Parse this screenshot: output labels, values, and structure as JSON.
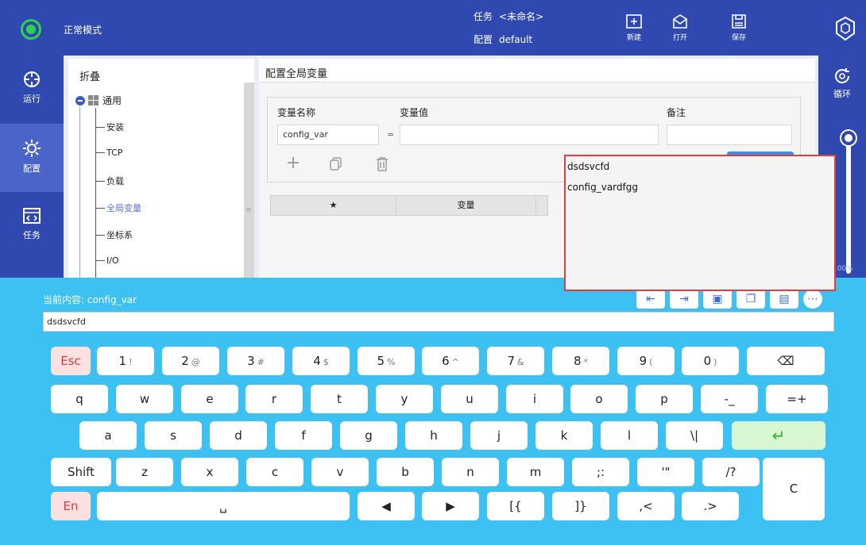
{
  "topbar": {
    "mode_label": "正常模式",
    "task_label": "任务",
    "task_value": "<未命名>",
    "config_label": "配置",
    "config_value": "default",
    "new_label": "新建",
    "open_label": "打开",
    "save_label": "保存"
  },
  "leftnav": {
    "items": [
      {
        "label": "运行",
        "icon": "run-icon"
      },
      {
        "label": "配置",
        "icon": "config-gear-icon"
      },
      {
        "label": "任务",
        "icon": "code-window-icon"
      }
    ]
  },
  "rightnav": {
    "loop_label": "循环",
    "speed_label": "100%",
    "speed_value": 100
  },
  "tree": {
    "title": "折叠",
    "root_label": "通用",
    "children": [
      "安装",
      "TCP",
      "负载",
      "全局变量",
      "坐标系",
      "I/O"
    ],
    "selected": "全局变量"
  },
  "main": {
    "title": "配置全局变量",
    "name_label": "变量名称",
    "value_label": "变量值",
    "note_label": "备注",
    "name_value": "config_var",
    "equals": "=",
    "table_headers": [
      "★",
      "变量"
    ]
  },
  "suggestions": [
    "dsdsvcfd",
    "config_vardfgg"
  ],
  "keyboard": {
    "current_label": "当前内容: config_var",
    "input_value": "dsdsvcfd",
    "edit_tools": [
      "move-left-icon",
      "move-right-icon",
      "select-all-icon",
      "copy-icon",
      "paste-icon",
      "more-icon"
    ],
    "row1": [
      {
        "main": "Esc",
        "sub": ""
      },
      {
        "main": "1",
        "sub": "!"
      },
      {
        "main": "2",
        "sub": "@"
      },
      {
        "main": "3",
        "sub": "#"
      },
      {
        "main": "4",
        "sub": "$"
      },
      {
        "main": "5",
        "sub": "%"
      },
      {
        "main": "6",
        "sub": "^"
      },
      {
        "main": "7",
        "sub": "&"
      },
      {
        "main": "8",
        "sub": "*"
      },
      {
        "main": "9",
        "sub": "("
      },
      {
        "main": "0",
        "sub": ")"
      },
      {
        "main": "⌫",
        "sub": ""
      }
    ],
    "row2": [
      "q",
      "w",
      "e",
      "r",
      "t",
      "y",
      "u",
      "i",
      "o",
      "p",
      "-_",
      "=+"
    ],
    "row3": [
      "a",
      "s",
      "d",
      "f",
      "g",
      "h",
      "j",
      "k",
      "l",
      "\\|",
      "↵"
    ],
    "row4": [
      "Shift",
      "z",
      "x",
      "c",
      "v",
      "b",
      "n",
      "m",
      ";:",
      "'\"",
      "/?"
    ],
    "row5": [
      "En",
      "␣",
      "◀",
      "▶",
      "[{",
      "]}",
      ",<",
      ".>"
    ],
    "clear_label": "C"
  }
}
